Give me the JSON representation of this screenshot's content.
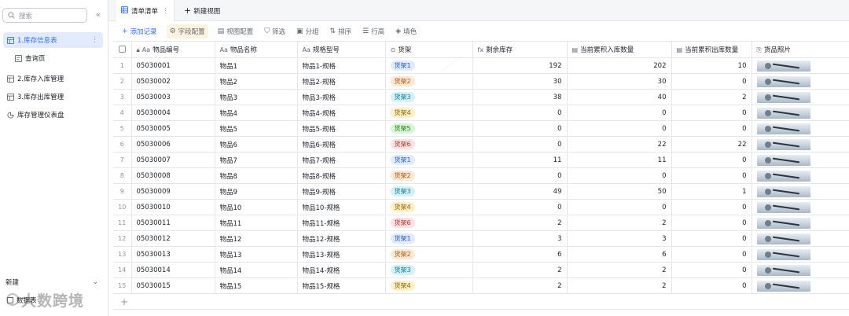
{
  "sidebar": {
    "search_placeholder": "搜索",
    "items": [
      {
        "label": "1.库存信息表",
        "icon": "table-icon",
        "active": true
      },
      {
        "label": "查询页",
        "icon": "form-icon",
        "active": false,
        "sub": true
      },
      {
        "label": "2.库存入库管理",
        "icon": "table-icon",
        "active": false
      },
      {
        "label": "3.库存出库管理",
        "icon": "table-icon",
        "active": false
      },
      {
        "label": "库存管理仪表盘",
        "icon": "dashboard-icon",
        "active": false
      }
    ],
    "new_label": "新建",
    "data_table_label": "数据表",
    "brand_mark": "大数跨境"
  },
  "tabs": {
    "active_view": "清单清单",
    "new_view": "新建视图"
  },
  "toolbar": {
    "add_record": "添加记录",
    "field_config": "字段配置",
    "view_config": "视图配置",
    "filter": "筛选",
    "group": "分组",
    "sort": "排序",
    "row_height": "行高",
    "fill_color": "填色"
  },
  "columns": [
    {
      "label": "物品编号",
      "icon": "Aa"
    },
    {
      "label": "物品名称",
      "icon": "Aa"
    },
    {
      "label": "规格型号",
      "icon": "Aa"
    },
    {
      "label": "货架",
      "icon": "⊙"
    },
    {
      "label": "剩余库存",
      "icon": "fx"
    },
    {
      "label": "当前累积入库数量",
      "icon": "▤"
    },
    {
      "label": "当前累积出库数量",
      "icon": "▤"
    },
    {
      "label": "货品照片",
      "icon": "⎘"
    }
  ],
  "shelf_colors": {
    "货架1": {
      "bg": "#e1eaff",
      "fg": "#245bdb"
    },
    "货架2": {
      "bg": "#fde8d4",
      "fg": "#b2570a"
    },
    "货架3": {
      "bg": "#d6f0f5",
      "fg": "#037d96"
    },
    "货架4": {
      "bg": "#fcf0c8",
      "fg": "#946300"
    },
    "货架5": {
      "bg": "#d9f5d6",
      "fg": "#237b19"
    },
    "货架6": {
      "bg": "#fde2e2",
      "fg": "#c02d2d"
    }
  },
  "rows": [
    {
      "idx": "1",
      "code": "05030001",
      "name": "物品1",
      "spec": "物品1-规格",
      "shelf": "货架1",
      "stock": "192",
      "in": "202",
      "out": "10"
    },
    {
      "idx": "2",
      "code": "05030002",
      "name": "物品2",
      "spec": "物品2-规格",
      "shelf": "货架2",
      "stock": "30",
      "in": "30",
      "out": "0"
    },
    {
      "idx": "3",
      "code": "05030003",
      "name": "物品3",
      "spec": "物品3-规格",
      "shelf": "货架3",
      "stock": "38",
      "in": "40",
      "out": "2"
    },
    {
      "idx": "4",
      "code": "05030004",
      "name": "物品4",
      "spec": "物品4-规格",
      "shelf": "货架4",
      "stock": "0",
      "in": "0",
      "out": "0"
    },
    {
      "idx": "5",
      "code": "05030005",
      "name": "物品5",
      "spec": "物品5-规格",
      "shelf": "货架5",
      "stock": "0",
      "in": "0",
      "out": "0"
    },
    {
      "idx": "6",
      "code": "05030006",
      "name": "物品6",
      "spec": "物品6-规格",
      "shelf": "货架6",
      "stock": "0",
      "in": "22",
      "out": "22"
    },
    {
      "idx": "7",
      "code": "05030007",
      "name": "物品7",
      "spec": "物品7-规格",
      "shelf": "货架1",
      "stock": "11",
      "in": "11",
      "out": "0"
    },
    {
      "idx": "8",
      "code": "05030008",
      "name": "物品8",
      "spec": "物品8-规格",
      "shelf": "货架2",
      "stock": "0",
      "in": "0",
      "out": "0"
    },
    {
      "idx": "9",
      "code": "05030009",
      "name": "物品9",
      "spec": "物品9-规格",
      "shelf": "货架3",
      "stock": "49",
      "in": "50",
      "out": "1"
    },
    {
      "idx": "10",
      "code": "05030010",
      "name": "物品10",
      "spec": "物品10-规格",
      "shelf": "货架4",
      "stock": "0",
      "in": "0",
      "out": "0"
    },
    {
      "idx": "11",
      "code": "05030011",
      "name": "物品11",
      "spec": "物品11-规格",
      "shelf": "货架6",
      "stock": "2",
      "in": "2",
      "out": "0"
    },
    {
      "idx": "12",
      "code": "05030012",
      "name": "物品12",
      "spec": "物品12-规格",
      "shelf": "货架1",
      "stock": "3",
      "in": "3",
      "out": "0"
    },
    {
      "idx": "13",
      "code": "05030013",
      "name": "物品13",
      "spec": "物品13-规格",
      "shelf": "货架2",
      "stock": "6",
      "in": "6",
      "out": "0"
    },
    {
      "idx": "14",
      "code": "05030014",
      "name": "物品14",
      "spec": "物品14-规格",
      "shelf": "货架3",
      "stock": "2",
      "in": "2",
      "out": "0"
    },
    {
      "idx": "15",
      "code": "05030015",
      "name": "物品15",
      "spec": "物品15-规格",
      "shelf": "货架4",
      "stock": "2",
      "in": "2",
      "out": "0"
    }
  ]
}
